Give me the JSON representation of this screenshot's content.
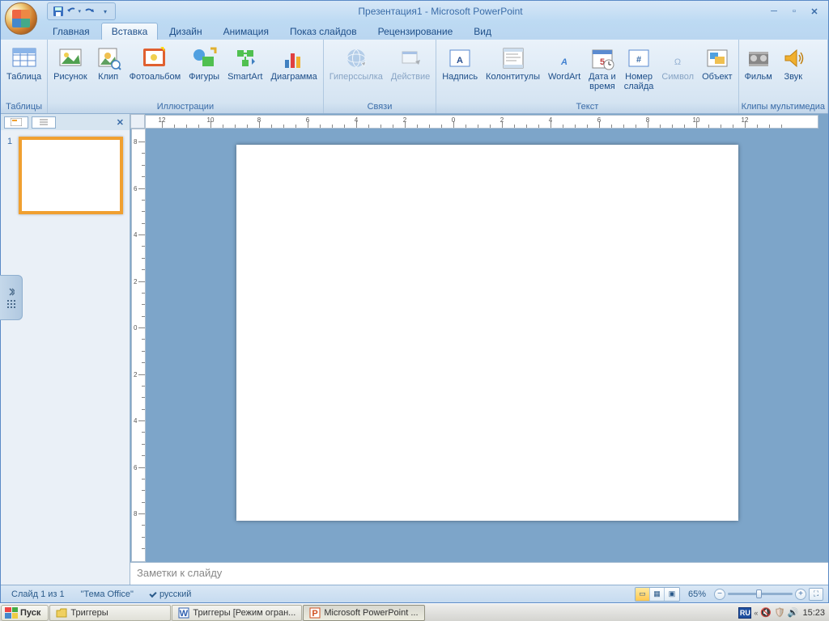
{
  "title": "Презентация1 - Microsoft PowerPoint",
  "tabs": [
    "Главная",
    "Вставка",
    "Дизайн",
    "Анимация",
    "Показ слайдов",
    "Рецензирование",
    "Вид"
  ],
  "active_tab": 1,
  "ribbon": {
    "groups": [
      {
        "label": "Таблицы",
        "items": [
          {
            "name": "table",
            "label": "Таблица"
          }
        ]
      },
      {
        "label": "Иллюстрации",
        "items": [
          {
            "name": "picture",
            "label": "Рисунок"
          },
          {
            "name": "clip",
            "label": "Клип"
          },
          {
            "name": "photoalbum",
            "label": "Фотоальбом"
          },
          {
            "name": "shapes",
            "label": "Фигуры"
          },
          {
            "name": "smartart",
            "label": "SmartArt"
          },
          {
            "name": "chart",
            "label": "Диаграмма"
          }
        ]
      },
      {
        "label": "Связи",
        "items": [
          {
            "name": "hyperlink",
            "label": "Гиперссылка",
            "disabled": true
          },
          {
            "name": "action",
            "label": "Действие",
            "disabled": true
          }
        ]
      },
      {
        "label": "Текст",
        "items": [
          {
            "name": "textbox",
            "label": "Надпись"
          },
          {
            "name": "headerfooter",
            "label": "Колонтитулы"
          },
          {
            "name": "wordart",
            "label": "WordArt"
          },
          {
            "name": "datetime",
            "label": "Дата и\nвремя"
          },
          {
            "name": "slidenumber",
            "label": "Номер\nслайда"
          },
          {
            "name": "symbol",
            "label": "Символ",
            "disabled": true
          },
          {
            "name": "object",
            "label": "Объект"
          }
        ]
      },
      {
        "label": "Клипы мультимедиа",
        "items": [
          {
            "name": "movie",
            "label": "Фильм"
          },
          {
            "name": "sound",
            "label": "Звук"
          }
        ]
      }
    ]
  },
  "slide_thumb_number": "1",
  "notes_placeholder": "Заметки к слайду",
  "status": {
    "slide": "Слайд 1 из 1",
    "theme": "\"Тема Office\"",
    "lang": "русский",
    "zoom": "65%"
  },
  "ruler_major": [
    "12",
    "10",
    "8",
    "6",
    "4",
    "2",
    "0",
    "2",
    "4",
    "6",
    "8",
    "10",
    "12"
  ],
  "v_ruler_major": [
    "8",
    "6",
    "4",
    "2",
    "0",
    "2",
    "4",
    "6",
    "8"
  ],
  "taskbar": {
    "start": "Пуск",
    "tasks": [
      {
        "label": "Триггеры",
        "icon": "folder"
      },
      {
        "label": "Триггеры [Режим огран...",
        "icon": "word"
      },
      {
        "label": "Microsoft PowerPoint ...",
        "icon": "ppt",
        "active": true
      }
    ],
    "lang": "RU",
    "time": "15:23"
  }
}
